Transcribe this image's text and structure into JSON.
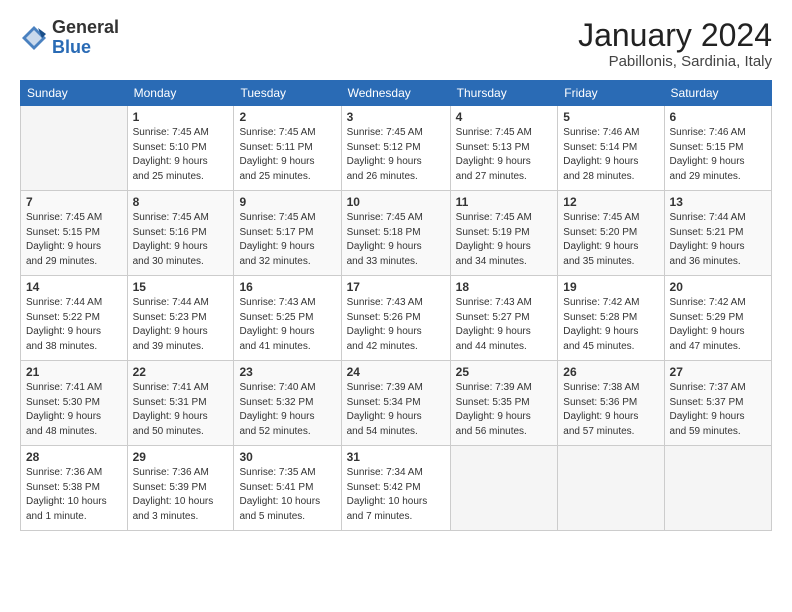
{
  "logo": {
    "general": "General",
    "blue": "Blue"
  },
  "title": "January 2024",
  "location": "Pabillonis, Sardinia, Italy",
  "days_of_week": [
    "Sunday",
    "Monday",
    "Tuesday",
    "Wednesday",
    "Thursday",
    "Friday",
    "Saturday"
  ],
  "weeks": [
    [
      {
        "num": "",
        "empty": true
      },
      {
        "num": "1",
        "sunrise": "Sunrise: 7:45 AM",
        "sunset": "Sunset: 5:10 PM",
        "daylight": "Daylight: 9 hours and 25 minutes."
      },
      {
        "num": "2",
        "sunrise": "Sunrise: 7:45 AM",
        "sunset": "Sunset: 5:11 PM",
        "daylight": "Daylight: 9 hours and 25 minutes."
      },
      {
        "num": "3",
        "sunrise": "Sunrise: 7:45 AM",
        "sunset": "Sunset: 5:12 PM",
        "daylight": "Daylight: 9 hours and 26 minutes."
      },
      {
        "num": "4",
        "sunrise": "Sunrise: 7:45 AM",
        "sunset": "Sunset: 5:13 PM",
        "daylight": "Daylight: 9 hours and 27 minutes."
      },
      {
        "num": "5",
        "sunrise": "Sunrise: 7:46 AM",
        "sunset": "Sunset: 5:14 PM",
        "daylight": "Daylight: 9 hours and 28 minutes."
      },
      {
        "num": "6",
        "sunrise": "Sunrise: 7:46 AM",
        "sunset": "Sunset: 5:15 PM",
        "daylight": "Daylight: 9 hours and 29 minutes."
      }
    ],
    [
      {
        "num": "7",
        "sunrise": "Sunrise: 7:45 AM",
        "sunset": "Sunset: 5:15 PM",
        "daylight": "Daylight: 9 hours and 29 minutes."
      },
      {
        "num": "8",
        "sunrise": "Sunrise: 7:45 AM",
        "sunset": "Sunset: 5:16 PM",
        "daylight": "Daylight: 9 hours and 30 minutes."
      },
      {
        "num": "9",
        "sunrise": "Sunrise: 7:45 AM",
        "sunset": "Sunset: 5:17 PM",
        "daylight": "Daylight: 9 hours and 32 minutes."
      },
      {
        "num": "10",
        "sunrise": "Sunrise: 7:45 AM",
        "sunset": "Sunset: 5:18 PM",
        "daylight": "Daylight: 9 hours and 33 minutes."
      },
      {
        "num": "11",
        "sunrise": "Sunrise: 7:45 AM",
        "sunset": "Sunset: 5:19 PM",
        "daylight": "Daylight: 9 hours and 34 minutes."
      },
      {
        "num": "12",
        "sunrise": "Sunrise: 7:45 AM",
        "sunset": "Sunset: 5:20 PM",
        "daylight": "Daylight: 9 hours and 35 minutes."
      },
      {
        "num": "13",
        "sunrise": "Sunrise: 7:44 AM",
        "sunset": "Sunset: 5:21 PM",
        "daylight": "Daylight: 9 hours and 36 minutes."
      }
    ],
    [
      {
        "num": "14",
        "sunrise": "Sunrise: 7:44 AM",
        "sunset": "Sunset: 5:22 PM",
        "daylight": "Daylight: 9 hours and 38 minutes."
      },
      {
        "num": "15",
        "sunrise": "Sunrise: 7:44 AM",
        "sunset": "Sunset: 5:23 PM",
        "daylight": "Daylight: 9 hours and 39 minutes."
      },
      {
        "num": "16",
        "sunrise": "Sunrise: 7:43 AM",
        "sunset": "Sunset: 5:25 PM",
        "daylight": "Daylight: 9 hours and 41 minutes."
      },
      {
        "num": "17",
        "sunrise": "Sunrise: 7:43 AM",
        "sunset": "Sunset: 5:26 PM",
        "daylight": "Daylight: 9 hours and 42 minutes."
      },
      {
        "num": "18",
        "sunrise": "Sunrise: 7:43 AM",
        "sunset": "Sunset: 5:27 PM",
        "daylight": "Daylight: 9 hours and 44 minutes."
      },
      {
        "num": "19",
        "sunrise": "Sunrise: 7:42 AM",
        "sunset": "Sunset: 5:28 PM",
        "daylight": "Daylight: 9 hours and 45 minutes."
      },
      {
        "num": "20",
        "sunrise": "Sunrise: 7:42 AM",
        "sunset": "Sunset: 5:29 PM",
        "daylight": "Daylight: 9 hours and 47 minutes."
      }
    ],
    [
      {
        "num": "21",
        "sunrise": "Sunrise: 7:41 AM",
        "sunset": "Sunset: 5:30 PM",
        "daylight": "Daylight: 9 hours and 48 minutes."
      },
      {
        "num": "22",
        "sunrise": "Sunrise: 7:41 AM",
        "sunset": "Sunset: 5:31 PM",
        "daylight": "Daylight: 9 hours and 50 minutes."
      },
      {
        "num": "23",
        "sunrise": "Sunrise: 7:40 AM",
        "sunset": "Sunset: 5:32 PM",
        "daylight": "Daylight: 9 hours and 52 minutes."
      },
      {
        "num": "24",
        "sunrise": "Sunrise: 7:39 AM",
        "sunset": "Sunset: 5:34 PM",
        "daylight": "Daylight: 9 hours and 54 minutes."
      },
      {
        "num": "25",
        "sunrise": "Sunrise: 7:39 AM",
        "sunset": "Sunset: 5:35 PM",
        "daylight": "Daylight: 9 hours and 56 minutes."
      },
      {
        "num": "26",
        "sunrise": "Sunrise: 7:38 AM",
        "sunset": "Sunset: 5:36 PM",
        "daylight": "Daylight: 9 hours and 57 minutes."
      },
      {
        "num": "27",
        "sunrise": "Sunrise: 7:37 AM",
        "sunset": "Sunset: 5:37 PM",
        "daylight": "Daylight: 9 hours and 59 minutes."
      }
    ],
    [
      {
        "num": "28",
        "sunrise": "Sunrise: 7:36 AM",
        "sunset": "Sunset: 5:38 PM",
        "daylight": "Daylight: 10 hours and 1 minute."
      },
      {
        "num": "29",
        "sunrise": "Sunrise: 7:36 AM",
        "sunset": "Sunset: 5:39 PM",
        "daylight": "Daylight: 10 hours and 3 minutes."
      },
      {
        "num": "30",
        "sunrise": "Sunrise: 7:35 AM",
        "sunset": "Sunset: 5:41 PM",
        "daylight": "Daylight: 10 hours and 5 minutes."
      },
      {
        "num": "31",
        "sunrise": "Sunrise: 7:34 AM",
        "sunset": "Sunset: 5:42 PM",
        "daylight": "Daylight: 10 hours and 7 minutes."
      },
      {
        "num": "",
        "empty": true
      },
      {
        "num": "",
        "empty": true
      },
      {
        "num": "",
        "empty": true
      }
    ]
  ]
}
